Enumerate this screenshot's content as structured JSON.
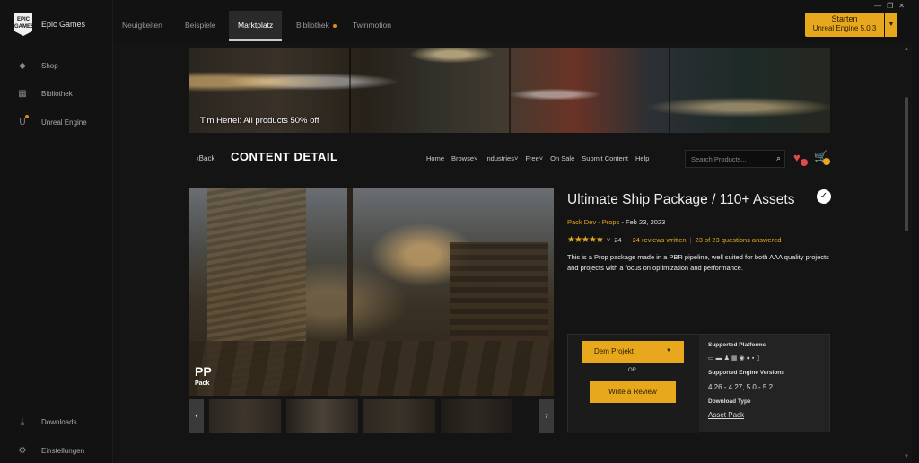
{
  "app": {
    "name": "Epic Games",
    "logo_text": "EPIC GAMES"
  },
  "sidebar": {
    "items": [
      {
        "label": "Shop",
        "icon": "tag-icon"
      },
      {
        "label": "Bibliothek",
        "icon": "grid-icon"
      },
      {
        "label": "Unreal Engine",
        "icon": "unreal-icon"
      }
    ],
    "bottom": [
      {
        "label": "Downloads",
        "icon": "download-icon"
      },
      {
        "label": "Einstellungen",
        "icon": "gear-icon"
      }
    ]
  },
  "tabs": [
    "Neuigkeiten",
    "Beispiele",
    "Marktplatz",
    "Bibliothek",
    "Twinmotion"
  ],
  "active_tab": "Marktplatz",
  "launch": {
    "label": "Starten",
    "version": "Unreal Engine 5.0.3"
  },
  "banner": {
    "caption": "Tim Hertel: All products 50% off"
  },
  "subnav": {
    "back": "‹Back",
    "title": "CONTENT DETAIL",
    "links": [
      "Home",
      "Browse",
      "Industries",
      "Free",
      "On Sale",
      "Submit Content",
      "Help"
    ],
    "search_placeholder": "Search Products..."
  },
  "gallery": {
    "watermark": "PP",
    "watermark_sub": "Pack",
    "thumb_count": 4
  },
  "product": {
    "title": "Ultimate Ship Package / 110+ Assets",
    "publisher": "Pack Dev - Props",
    "date": "Feb 23, 2023",
    "rating_count": "24",
    "reviews": "24 reviews written",
    "questions": "23 of 23 questions answered",
    "description": "This is a Prop package made in a PBR pipeline, well suited for both AAA quality projects and projects with a focus on optimization and performance."
  },
  "actions": {
    "project_button": "Dem Projekt",
    "or": "OR",
    "review_button": "Write a Review",
    "platforms_label": "Supported Platforms",
    "engine_label": "Supported Engine Versions",
    "engine_versions": "4.26 - 4.27, 5.0 - 5.2",
    "download_label": "Download Type",
    "download_type": "Asset Pack"
  },
  "colors": {
    "accent": "#e7a81d",
    "bg": "#121212",
    "panel": "#232323"
  }
}
